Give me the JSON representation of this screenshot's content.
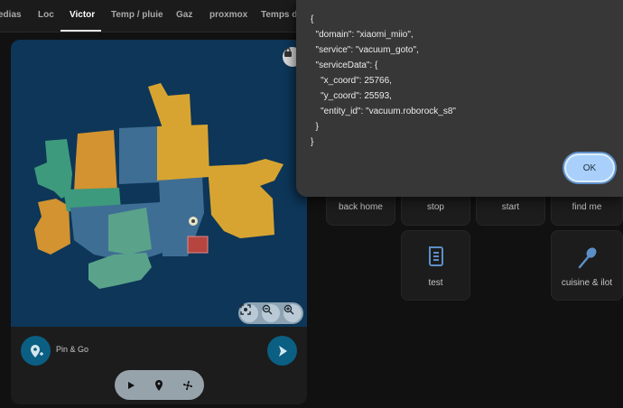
{
  "tabs": [
    "edias",
    "Loc",
    "Victor",
    "Temp / pluie",
    "Gaz",
    "proxmox",
    "Temps d'a"
  ],
  "active_tab": "Victor",
  "map_controls": {
    "pin_go_label": "Pin & Go",
    "lock_icon": "lock-icon",
    "zoom_icons": [
      "fit-screen-icon",
      "zoom-out-icon",
      "zoom-in-icon"
    ],
    "mode_icons": [
      "play-icon",
      "pin-icon",
      "fan-icon"
    ]
  },
  "colors": {
    "room_teal": "#3d9a7c",
    "room_yellow": "#d8a431",
    "room_orange": "#d29330",
    "room_blue": "#3f6e95",
    "room_green": "#5aa38a",
    "map_bg": "#0d3658",
    "accent": "#0a5f83"
  },
  "tiles": [
    {
      "label": "back home"
    },
    {
      "label": "stop"
    },
    {
      "label": "start"
    },
    {
      "label": "find me"
    },
    {
      "label": "test",
      "icon": "script-icon"
    },
    {
      "label": "cuisine & ilot",
      "icon": "broom-icon"
    }
  ],
  "dialog": {
    "code": "{\n  \"domain\": \"xiaomi_miio\",\n  \"service\": \"vacuum_goto\",\n  \"serviceData\": {\n    \"x_coord\": 25766,\n    \"y_coord\": 25593,\n    \"entity_id\": \"vacuum.roborock_s8\"\n  }\n}",
    "ok_label": "OK"
  }
}
